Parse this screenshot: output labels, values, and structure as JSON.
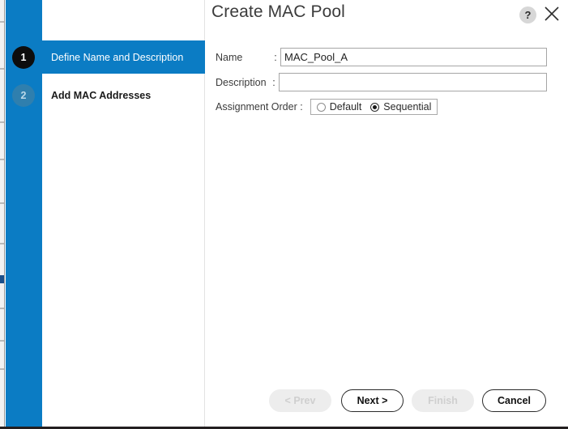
{
  "dialog": {
    "title": "Create MAC Pool",
    "help_icon_label": "?",
    "help_icon_name": "help-icon",
    "close_icon_name": "close-icon",
    "accent_blue": "#0b7cc4",
    "active_step_badge_color": "#0d0d0d",
    "inactive_step_badge_color": "#2f7fae"
  },
  "sidebar": {
    "steps": [
      {
        "number": "1",
        "label": "Define Name and Description",
        "active": true
      },
      {
        "number": "2",
        "label": "Add MAC Addresses",
        "active": false
      }
    ]
  },
  "form": {
    "name": {
      "label": "Name",
      "separator": ":",
      "value": "MAC_Pool_A",
      "placeholder": ""
    },
    "description": {
      "label": "Description",
      "separator": ":",
      "value": "",
      "placeholder": ""
    },
    "assignment_order": {
      "label": "Assignment Order :",
      "options": [
        {
          "label": "Default",
          "selected": false
        },
        {
          "label": "Sequential",
          "selected": true
        }
      ],
      "selected_value": "Sequential"
    }
  },
  "footer": {
    "prev_label": "< Prev",
    "prev_enabled": false,
    "next_label": "Next >",
    "next_enabled": true,
    "finish_label": "Finish",
    "finish_enabled": false,
    "cancel_label": "Cancel",
    "cancel_enabled": true
  }
}
